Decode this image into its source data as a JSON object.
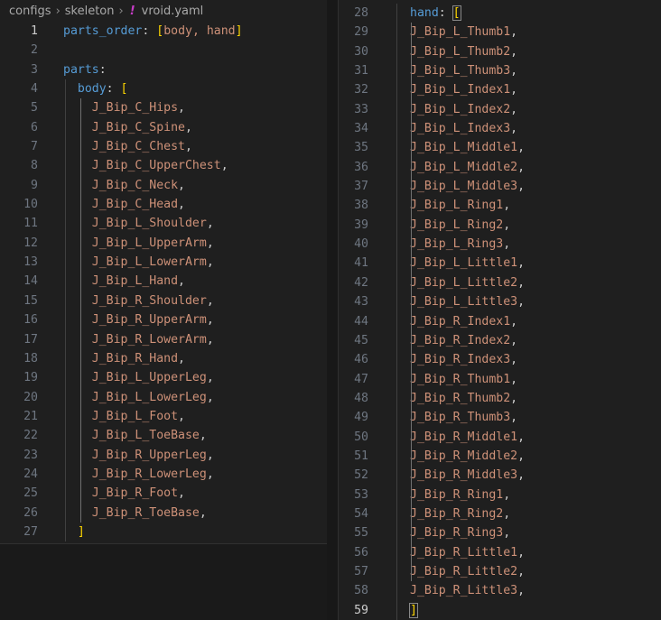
{
  "breadcrumb": {
    "items": [
      "configs",
      "skeleton",
      "vroid.yaml"
    ]
  },
  "left_editor": {
    "lines": [
      {
        "n": "1",
        "indent": "",
        "key": "parts_order",
        "rest_open": "[body, hand]"
      },
      {
        "n": "2",
        "indent": ""
      },
      {
        "n": "3",
        "indent": "",
        "key": "parts"
      },
      {
        "n": "4",
        "indent": "  ",
        "key": "body",
        "bracket": "["
      },
      {
        "n": "5",
        "indent": "    ",
        "value": "J_Bip_C_Hips,"
      },
      {
        "n": "6",
        "indent": "    ",
        "value": "J_Bip_C_Spine,"
      },
      {
        "n": "7",
        "indent": "    ",
        "value": "J_Bip_C_Chest,"
      },
      {
        "n": "8",
        "indent": "    ",
        "value": "J_Bip_C_UpperChest,"
      },
      {
        "n": "9",
        "indent": "    ",
        "value": "J_Bip_C_Neck,"
      },
      {
        "n": "10",
        "indent": "    ",
        "value": "J_Bip_C_Head,"
      },
      {
        "n": "11",
        "indent": "    ",
        "value": "J_Bip_L_Shoulder,"
      },
      {
        "n": "12",
        "indent": "    ",
        "value": "J_Bip_L_UpperArm,"
      },
      {
        "n": "13",
        "indent": "    ",
        "value": "J_Bip_L_LowerArm,"
      },
      {
        "n": "14",
        "indent": "    ",
        "value": "J_Bip_L_Hand,"
      },
      {
        "n": "15",
        "indent": "    ",
        "value": "J_Bip_R_Shoulder,"
      },
      {
        "n": "16",
        "indent": "    ",
        "value": "J_Bip_R_UpperArm,"
      },
      {
        "n": "17",
        "indent": "    ",
        "value": "J_Bip_R_LowerArm,"
      },
      {
        "n": "18",
        "indent": "    ",
        "value": "J_Bip_R_Hand,"
      },
      {
        "n": "19",
        "indent": "    ",
        "value": "J_Bip_L_UpperLeg,"
      },
      {
        "n": "20",
        "indent": "    ",
        "value": "J_Bip_L_LowerLeg,"
      },
      {
        "n": "21",
        "indent": "    ",
        "value": "J_Bip_L_Foot,"
      },
      {
        "n": "22",
        "indent": "    ",
        "value": "J_Bip_L_ToeBase,"
      },
      {
        "n": "23",
        "indent": "    ",
        "value": "J_Bip_R_UpperLeg,"
      },
      {
        "n": "24",
        "indent": "    ",
        "value": "J_Bip_R_LowerLeg,"
      },
      {
        "n": "25",
        "indent": "    ",
        "value": "J_Bip_R_Foot,"
      },
      {
        "n": "26",
        "indent": "    ",
        "value": "J_Bip_R_ToeBase,"
      },
      {
        "n": "27",
        "indent": "  ",
        "bracket": "]"
      }
    ],
    "active_line": "1"
  },
  "right_editor": {
    "lines": [
      {
        "n": "28",
        "key": "hand",
        "bracket": "["
      },
      {
        "n": "29",
        "value": "J_Bip_L_Thumb1,"
      },
      {
        "n": "30",
        "value": "J_Bip_L_Thumb2,"
      },
      {
        "n": "31",
        "value": "J_Bip_L_Thumb3,"
      },
      {
        "n": "32",
        "value": "J_Bip_L_Index1,"
      },
      {
        "n": "33",
        "value": "J_Bip_L_Index2,"
      },
      {
        "n": "34",
        "value": "J_Bip_L_Index3,"
      },
      {
        "n": "35",
        "value": "J_Bip_L_Middle1,"
      },
      {
        "n": "36",
        "value": "J_Bip_L_Middle2,"
      },
      {
        "n": "37",
        "value": "J_Bip_L_Middle3,"
      },
      {
        "n": "38",
        "value": "J_Bip_L_Ring1,"
      },
      {
        "n": "39",
        "value": "J_Bip_L_Ring2,"
      },
      {
        "n": "40",
        "value": "J_Bip_L_Ring3,"
      },
      {
        "n": "41",
        "value": "J_Bip_L_Little1,"
      },
      {
        "n": "42",
        "value": "J_Bip_L_Little2,"
      },
      {
        "n": "43",
        "value": "J_Bip_L_Little3,"
      },
      {
        "n": "44",
        "value": "J_Bip_R_Index1,"
      },
      {
        "n": "45",
        "value": "J_Bip_R_Index2,"
      },
      {
        "n": "46",
        "value": "J_Bip_R_Index3,"
      },
      {
        "n": "47",
        "value": "J_Bip_R_Thumb1,"
      },
      {
        "n": "48",
        "value": "J_Bip_R_Thumb2,"
      },
      {
        "n": "49",
        "value": "J_Bip_R_Thumb3,"
      },
      {
        "n": "50",
        "value": "J_Bip_R_Middle1,"
      },
      {
        "n": "51",
        "value": "J_Bip_R_Middle2,"
      },
      {
        "n": "52",
        "value": "J_Bip_R_Middle3,"
      },
      {
        "n": "53",
        "value": "J_Bip_R_Ring1,"
      },
      {
        "n": "54",
        "value": "J_Bip_R_Ring2,"
      },
      {
        "n": "55",
        "value": "J_Bip_R_Ring3,"
      },
      {
        "n": "56",
        "value": "J_Bip_R_Little1,"
      },
      {
        "n": "57",
        "value": "J_Bip_R_Little2,"
      },
      {
        "n": "58",
        "value": "J_Bip_R_Little3,"
      },
      {
        "n": "59",
        "bracket": "]"
      }
    ],
    "active_line": "59"
  },
  "colors": {
    "background": "#1f1f1f",
    "key": "#569cd6",
    "string": "#ce9178",
    "bracket": "#ffd700",
    "line_number": "#6e7681",
    "yaml_icon": "#c83cc8"
  }
}
